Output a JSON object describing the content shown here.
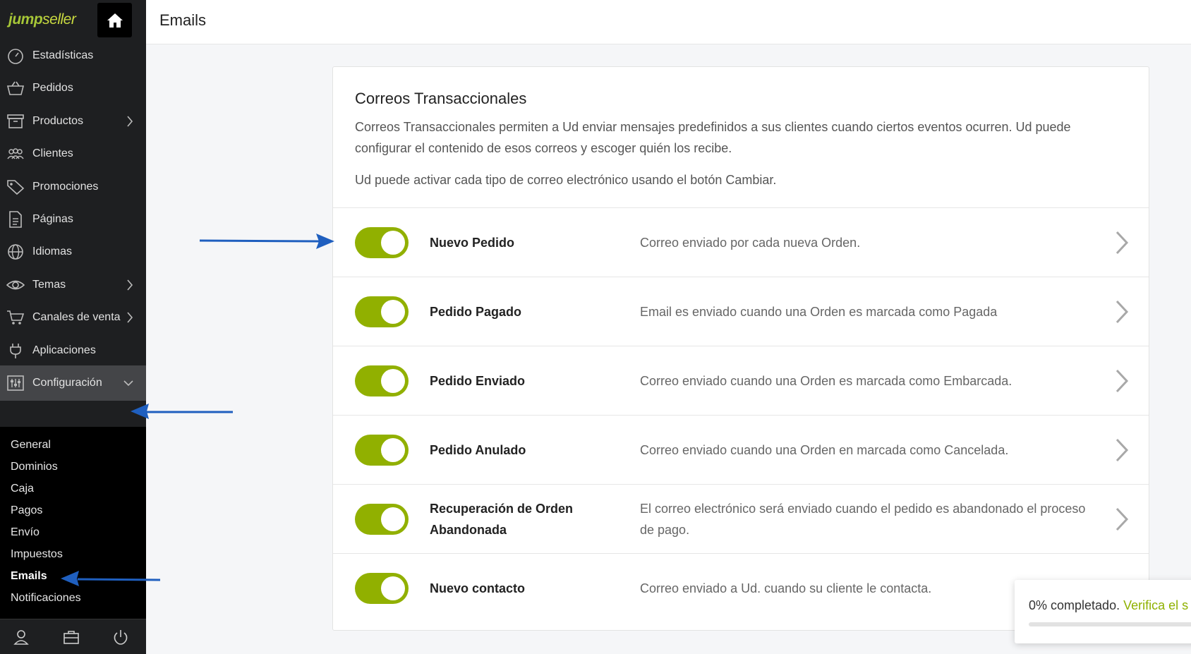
{
  "brand": {
    "logo_main": "jump",
    "logo_suffix": "seller"
  },
  "sidebar": {
    "items": [
      {
        "label": "Estadísticas",
        "icon": "gauge-icon",
        "chevron": false
      },
      {
        "label": "Pedidos",
        "icon": "basket-icon",
        "chevron": false
      },
      {
        "label": "Productos",
        "icon": "box-icon",
        "chevron": true
      },
      {
        "label": "Clientes",
        "icon": "users-icon",
        "chevron": false
      },
      {
        "label": "Promociones",
        "icon": "tag-icon",
        "chevron": false
      },
      {
        "label": "Páginas",
        "icon": "page-icon",
        "chevron": false
      },
      {
        "label": "Idiomas",
        "icon": "globe-icon",
        "chevron": false
      },
      {
        "label": "Temas",
        "icon": "eye-icon",
        "chevron": true
      },
      {
        "label": "Canales de venta",
        "icon": "cart-icon",
        "chevron": true
      },
      {
        "label": "Aplicaciones",
        "icon": "plug-icon",
        "chevron": false
      },
      {
        "label": "Configuración",
        "icon": "sliders-icon",
        "chevron": true,
        "active": true
      }
    ],
    "submenu": [
      {
        "label": "General"
      },
      {
        "label": "Dominios"
      },
      {
        "label": "Caja"
      },
      {
        "label": "Pagos"
      },
      {
        "label": "Envío"
      },
      {
        "label": "Impuestos"
      },
      {
        "label": "Emails",
        "current": true
      },
      {
        "label": "Notificaciones"
      }
    ]
  },
  "header": {
    "title": "Emails"
  },
  "main": {
    "card_title": "Correos Transaccionales",
    "card_description": "Correos Transaccionales permiten a Ud enviar mensajes predefinidos a sus clientes cuando ciertos eventos ocurren. Ud puede configurar el contenido de esos correos y escoger quién los recibe.",
    "card_note": "Ud puede activar cada tipo de correo electrónico usando el botón Cambiar.",
    "emails": [
      {
        "name": "Nuevo Pedido",
        "description": "Correo enviado por cada nueva Orden.",
        "enabled": true
      },
      {
        "name": "Pedido Pagado",
        "description": "Email es enviado cuando una Orden es marcada como Pagada",
        "enabled": true
      },
      {
        "name": "Pedido Enviado",
        "description": "Correo enviado cuando una Orden es marcada como Embarcada.",
        "enabled": true
      },
      {
        "name": "Pedido Anulado",
        "description": "Correo enviado cuando una Orden en marcada como Cancelada.",
        "enabled": true
      },
      {
        "name": "Recuperación de Orden Abandonada",
        "description": "El correo electrónico será enviado cuando el pedido es abandonado el proceso de pago.",
        "enabled": true
      },
      {
        "name": "Nuevo contacto",
        "description": "Correo enviado a Ud. cuando su cliente le contacta.",
        "enabled": true
      }
    ]
  },
  "progress": {
    "text": "0% completado.",
    "link": "Verifica el s",
    "percent": 0
  },
  "colors": {
    "accent": "#91b000",
    "sidebar_bg": "#1e1f21",
    "arrow": "#1f5fbf"
  }
}
